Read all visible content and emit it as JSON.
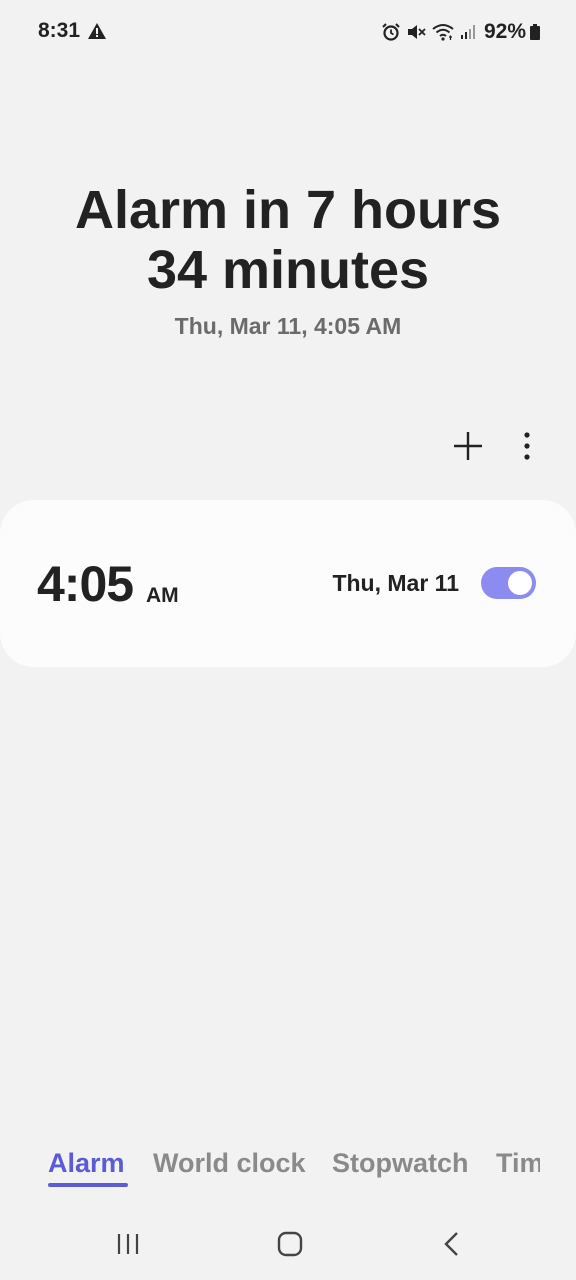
{
  "status_bar": {
    "time": "8:31",
    "battery_percent": "92%",
    "icons": [
      "warning-icon",
      "alarm-clock-icon",
      "mute-icon",
      "wifi-icon",
      "signal-icon",
      "battery-icon"
    ]
  },
  "header": {
    "headline_line1": "Alarm in 7 hours",
    "headline_line2": "34 minutes",
    "subline": "Thu, Mar 11, 4:05 AM"
  },
  "toolbar": {
    "icons": [
      "add-icon",
      "more-vert-icon"
    ]
  },
  "alarm": {
    "time": "4:05",
    "ampm": "AM",
    "date": "Thu, Mar 11",
    "enabled": true
  },
  "tabs": [
    {
      "label": "Alarm",
      "active": true
    },
    {
      "label": "World clock",
      "active": false
    },
    {
      "label": "Stopwatch",
      "active": false
    },
    {
      "label": "Timer",
      "active": false
    }
  ],
  "navbar": {
    "icons": [
      "recent-apps-icon",
      "home-icon",
      "back-icon"
    ]
  },
  "colors": {
    "accent": "#5b5bd6",
    "toggle_track": "#8b8bf0",
    "background": "#f2f2f2",
    "card": "#fcfcfc"
  }
}
